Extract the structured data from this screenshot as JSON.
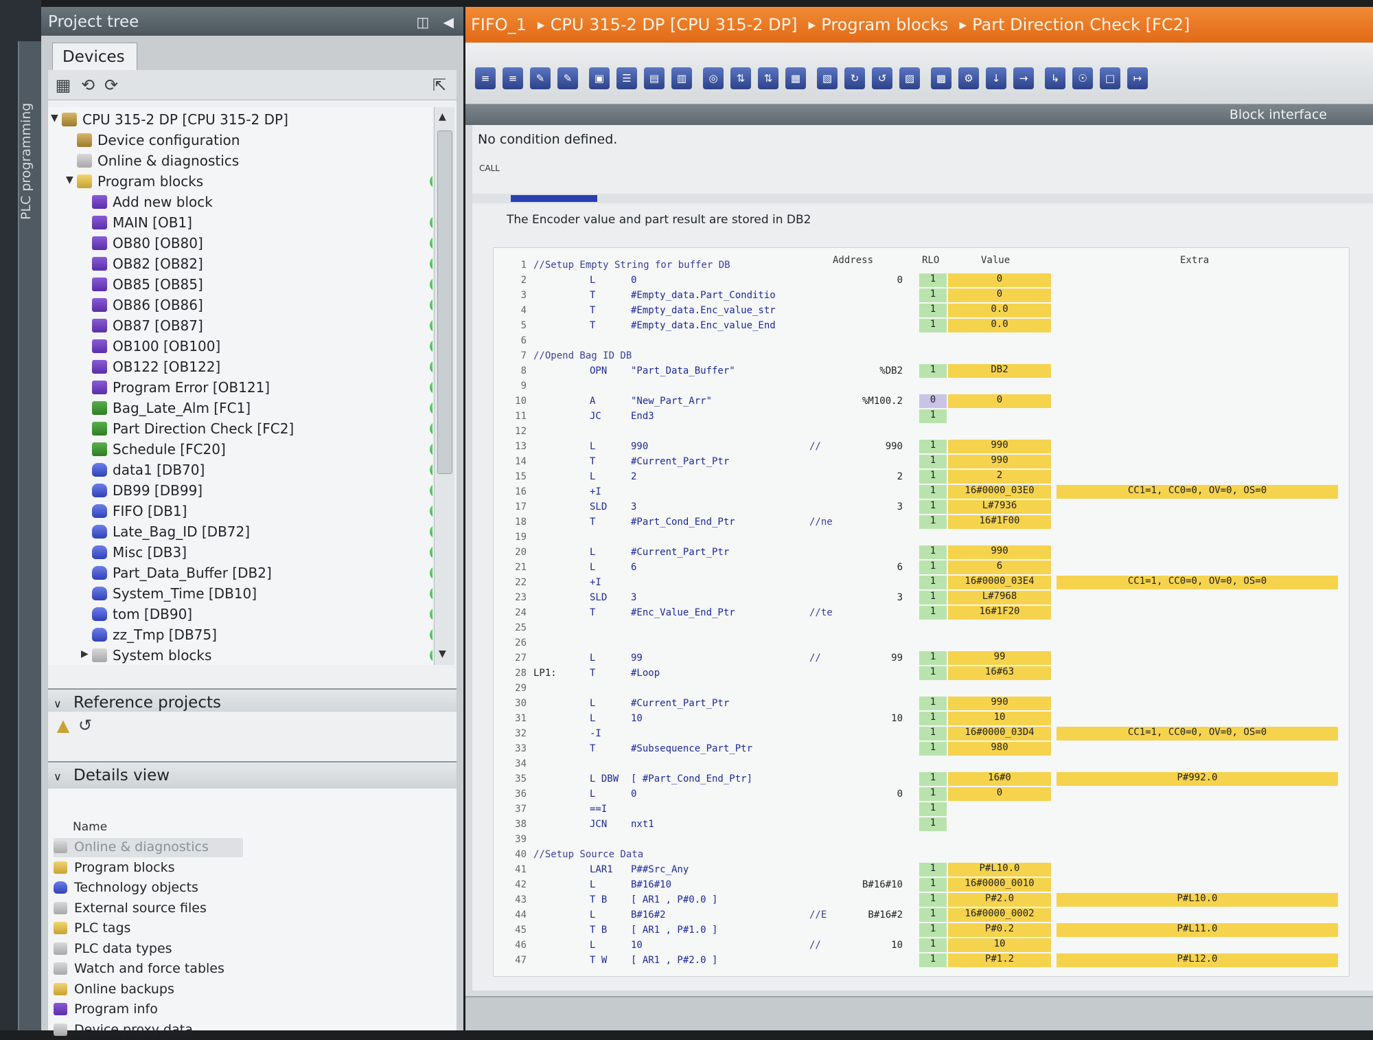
{
  "rail": {
    "label": "PLC programming"
  },
  "tree": {
    "header": "Project tree",
    "devices_tab": "Devices",
    "items": [
      {
        "label": "CPU 315-2 DP [CPU 315-2 DP]",
        "level": 0,
        "icon": "cpu-icon",
        "kind": "cfg",
        "expanded": true,
        "status": false
      },
      {
        "label": "Device configuration",
        "level": 1,
        "icon": "device-config-icon",
        "kind": "cfg",
        "status": false
      },
      {
        "label": "Online & diagnostics",
        "level": 1,
        "icon": "diagnostics-icon",
        "kind": "sys",
        "status": false
      },
      {
        "label": "Program blocks",
        "level": 1,
        "icon": "folder-icon",
        "kind": "fold",
        "expanded": true,
        "status": true
      },
      {
        "label": "Add new block",
        "level": 2,
        "icon": "add-block-icon",
        "kind": "ob",
        "status": false
      },
      {
        "label": "MAIN [OB1]",
        "level": 2,
        "icon": "ob-block-icon",
        "kind": "ob",
        "status": true
      },
      {
        "label": "OB80 [OB80]",
        "level": 2,
        "icon": "ob-block-icon",
        "kind": "ob",
        "status": true
      },
      {
        "label": "OB82 [OB82]",
        "level": 2,
        "icon": "ob-block-icon",
        "kind": "ob",
        "status": true
      },
      {
        "label": "OB85 [OB85]",
        "level": 2,
        "icon": "ob-block-icon",
        "kind": "ob",
        "status": true
      },
      {
        "label": "OB86 [OB86]",
        "level": 2,
        "icon": "ob-block-icon",
        "kind": "ob",
        "status": true
      },
      {
        "label": "OB87 [OB87]",
        "level": 2,
        "icon": "ob-block-icon",
        "kind": "ob",
        "status": true
      },
      {
        "label": "OB100 [OB100]",
        "level": 2,
        "icon": "ob-block-icon",
        "kind": "ob",
        "status": true
      },
      {
        "label": "OB122 [OB122]",
        "level": 2,
        "icon": "ob-block-icon",
        "kind": "ob",
        "status": true
      },
      {
        "label": "Program Error [OB121]",
        "level": 2,
        "icon": "ob-block-icon",
        "kind": "ob",
        "status": true
      },
      {
        "label": "Bag_Late_Alm [FC1]",
        "level": 2,
        "icon": "fc-block-icon",
        "kind": "fc",
        "status": true
      },
      {
        "label": "Part Direction Check [FC2]",
        "level": 2,
        "icon": "fc-block-icon",
        "kind": "fc",
        "status": true
      },
      {
        "label": "Schedule [FC20]",
        "level": 2,
        "icon": "fc-block-icon",
        "kind": "fc",
        "status": true
      },
      {
        "label": "data1 [DB70]",
        "level": 2,
        "icon": "db-block-icon",
        "kind": "db",
        "status": true
      },
      {
        "label": "DB99 [DB99]",
        "level": 2,
        "icon": "db-block-icon",
        "kind": "db",
        "status": true
      },
      {
        "label": "FIFO [DB1]",
        "level": 2,
        "icon": "db-block-icon",
        "kind": "db",
        "status": true
      },
      {
        "label": "Late_Bag_ID [DB72]",
        "level": 2,
        "icon": "db-block-icon",
        "kind": "db",
        "status": true
      },
      {
        "label": "Misc [DB3]",
        "level": 2,
        "icon": "db-block-icon",
        "kind": "db",
        "status": true
      },
      {
        "label": "Part_Data_Buffer [DB2]",
        "level": 2,
        "icon": "db-block-icon",
        "kind": "db",
        "status": true
      },
      {
        "label": "System_Time [DB10]",
        "level": 2,
        "icon": "db-block-icon",
        "kind": "db",
        "status": true
      },
      {
        "label": "tom [DB90]",
        "level": 2,
        "icon": "db-block-icon",
        "kind": "db",
        "status": true
      },
      {
        "label": "zz_Tmp [DB75]",
        "level": 2,
        "icon": "db-block-icon",
        "kind": "db",
        "status": true
      },
      {
        "label": "System blocks",
        "level": 2,
        "icon": "folder-icon",
        "kind": "sys",
        "collapsed": true,
        "status": true
      }
    ],
    "reference_projects": "Reference projects",
    "details_view": "Details view",
    "details_column": "Name",
    "details_items": [
      {
        "label": "Online & diagnostics",
        "kind": "sys"
      },
      {
        "label": "Program blocks",
        "kind": "fold"
      },
      {
        "label": "Technology objects",
        "kind": "db"
      },
      {
        "label": "External source files",
        "kind": "sys"
      },
      {
        "label": "PLC tags",
        "kind": "fold"
      },
      {
        "label": "PLC data types",
        "kind": "sys"
      },
      {
        "label": "Watch and force tables",
        "kind": "sys"
      },
      {
        "label": "Online backups",
        "kind": "fold"
      },
      {
        "label": "Program info",
        "kind": "ob"
      },
      {
        "label": "Device proxy data",
        "kind": "sys"
      }
    ]
  },
  "breadcrumb": [
    "FIFO_1",
    "CPU 315-2 DP [CPU 315-2 DP]",
    "Program blocks",
    "Part Direction Check [FC2]"
  ],
  "block_interface": "Block interface",
  "editor": {
    "no_condition": "No condition defined.",
    "call_label": "CALL",
    "network_comment": "The Encoder value and part result are stored in DB2",
    "columns": {
      "address": "Address",
      "rlo": "RLO",
      "value": "Value",
      "extra": "Extra"
    },
    "lines": [
      {
        "n": "1",
        "comment": "//Setup Empty String for buffer DB"
      },
      {
        "n": "2",
        "op": "L",
        "operand": "0",
        "addr": "0",
        "rlo": "1",
        "value": "0"
      },
      {
        "n": "3",
        "op": "T",
        "operand": "#Empty_data.Part_Conditio",
        "rlo": "1",
        "value": "0"
      },
      {
        "n": "4",
        "op": "T",
        "operand": "#Empty_data.Enc_value_str",
        "rlo": "1",
        "value": "0.0"
      },
      {
        "n": "5",
        "op": "T",
        "operand": "#Empty_data.Enc_value_End",
        "rlo": "1",
        "value": "0.0"
      },
      {
        "n": "6"
      },
      {
        "n": "7",
        "comment": "//Opend Bag ID DB"
      },
      {
        "n": "8",
        "op": "OPN",
        "operand": "\"Part_Data_Buffer\"",
        "addr": "%DB2",
        "rlo": "1",
        "value": "DB2"
      },
      {
        "n": "9"
      },
      {
        "n": "10",
        "op": "A",
        "operand": "\"New_Part_Arr\"",
        "addr": "%M100.2",
        "rlo": "0",
        "value": "0"
      },
      {
        "n": "11",
        "op": "JC",
        "operand": "End3",
        "rlo": "1"
      },
      {
        "n": "12"
      },
      {
        "n": "13",
        "op": "L",
        "operand": "990",
        "comment2": "//",
        "addr": "990",
        "rlo": "1",
        "value": "990"
      },
      {
        "n": "14",
        "op": "T",
        "operand": "#Current_Part_Ptr",
        "rlo": "1",
        "value": "990"
      },
      {
        "n": "15",
        "op": "L",
        "operand": "2",
        "addr": "2",
        "rlo": "1",
        "value": "2"
      },
      {
        "n": "16",
        "op": "+I",
        "rlo": "1",
        "value": "16#0000_03E0",
        "extra": "CC1=1, CC0=0, OV=0, OS=0"
      },
      {
        "n": "17",
        "op": "SLD",
        "operand": "3",
        "addr": "3",
        "rlo": "1",
        "value": "L#7936"
      },
      {
        "n": "18",
        "op": "T",
        "operand": "#Part_Cond_End_Ptr",
        "comment2": "//ne",
        "rlo": "1",
        "value": "16#1F00"
      },
      {
        "n": "19"
      },
      {
        "n": "20",
        "op": "L",
        "operand": "#Current_Part_Ptr",
        "rlo": "1",
        "value": "990"
      },
      {
        "n": "21",
        "op": "L",
        "operand": "6",
        "addr": "6",
        "rlo": "1",
        "value": "6"
      },
      {
        "n": "22",
        "op": "+I",
        "rlo": "1",
        "value": "16#0000_03E4",
        "extra": "CC1=1, CC0=0, OV=0, OS=0"
      },
      {
        "n": "23",
        "op": "SLD",
        "operand": "3",
        "addr": "3",
        "rlo": "1",
        "value": "L#7968"
      },
      {
        "n": "24",
        "op": "T",
        "operand": "#Enc_Value_End_Ptr",
        "comment2": "//te",
        "rlo": "1",
        "value": "16#1F20"
      },
      {
        "n": "25"
      },
      {
        "n": "26"
      },
      {
        "n": "27",
        "op": "L",
        "operand": "99",
        "comment2": "//",
        "addr": "99",
        "rlo": "1",
        "value": "99"
      },
      {
        "n": "28",
        "label": "LP1:",
        "op": "T",
        "operand": "#Loop",
        "rlo": "1",
        "value": "16#63"
      },
      {
        "n": "29"
      },
      {
        "n": "30",
        "op": "L",
        "operand": "#Current_Part_Ptr",
        "rlo": "1",
        "value": "990"
      },
      {
        "n": "31",
        "op": "L",
        "operand": "10",
        "addr": "10",
        "rlo": "1",
        "value": "10"
      },
      {
        "n": "32",
        "op": "-I",
        "rlo": "1",
        "value": "16#0000_03D4",
        "extra": "CC1=1, CC0=0, OV=0, OS=0"
      },
      {
        "n": "33",
        "op": "T",
        "operand": "#Subsequence_Part_Ptr",
        "rlo": "1",
        "value": "980"
      },
      {
        "n": "34"
      },
      {
        "n": "35",
        "op": "L DBW",
        "operand": "[ #Part_Cond_End_Ptr]",
        "rlo": "1",
        "value": "16#0",
        "extra": "P#992.0"
      },
      {
        "n": "36",
        "op": "L",
        "operand": "0",
        "addr": "0",
        "rlo": "1",
        "value": "0"
      },
      {
        "n": "37",
        "op": "==I",
        "rlo": "1"
      },
      {
        "n": "38",
        "op": "JCN",
        "operand": "nxt1",
        "rlo": "1"
      },
      {
        "n": "39"
      },
      {
        "n": "40",
        "comment": "//Setup Source Data"
      },
      {
        "n": "41",
        "op": "LAR1",
        "operand": "P##Src_Any",
        "rlo": "1",
        "value": "P#L10.0"
      },
      {
        "n": "42",
        "op": "L",
        "operand": "B#16#10",
        "addr": "B#16#10",
        "rlo": "1",
        "value": "16#0000_0010"
      },
      {
        "n": "43",
        "op": "T B",
        "operand": "[ AR1 , P#0.0 ]",
        "rlo": "1",
        "value": "P#2.0",
        "extra": "P#L10.0"
      },
      {
        "n": "44",
        "op": "L",
        "operand": "B#16#2",
        "comment2": "//E",
        "addr": "B#16#2",
        "rlo": "1",
        "value": "16#0000_0002"
      },
      {
        "n": "45",
        "op": "T B",
        "operand": "[ AR1 , P#1.0 ]",
        "rlo": "1",
        "value": "P#0.2",
        "extra": "P#L11.0"
      },
      {
        "n": "46",
        "op": "L",
        "operand": "10",
        "comment2": "//",
        "addr": "10",
        "rlo": "1",
        "value": "10"
      },
      {
        "n": "47",
        "op": "T W",
        "operand": "[ AR1 , P#2.0 ]",
        "rlo": "1",
        "value": "P#1.2",
        "extra": "P#L12.0"
      }
    ]
  }
}
